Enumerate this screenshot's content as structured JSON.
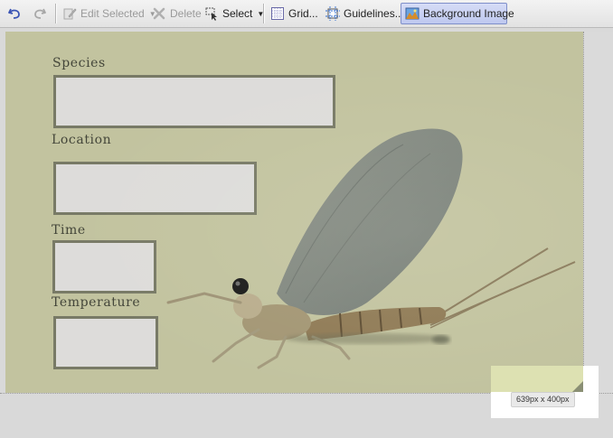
{
  "toolbar": {
    "undo_icon": "undo-arrow-icon",
    "redo_icon": "redo-arrow-icon",
    "edit_selected_label": "Edit Selected",
    "delete_label": "Delete",
    "select_label": "Select",
    "grid_label": "Grid...",
    "guidelines_label": "Guidelines...",
    "background_image_label": "Background Image"
  },
  "form": {
    "fields": [
      {
        "label": "Species"
      },
      {
        "label": "Location"
      },
      {
        "label": "Time"
      },
      {
        "label": "Temperature"
      }
    ]
  },
  "canvas": {
    "size_label": "639px x 400px",
    "background_subject": "mayfly"
  },
  "colors": {
    "canvas_bg": "#c2c39f",
    "field_border": "#787a66",
    "field_fill": "#dddcda",
    "active_button": "#c8d0f2"
  }
}
